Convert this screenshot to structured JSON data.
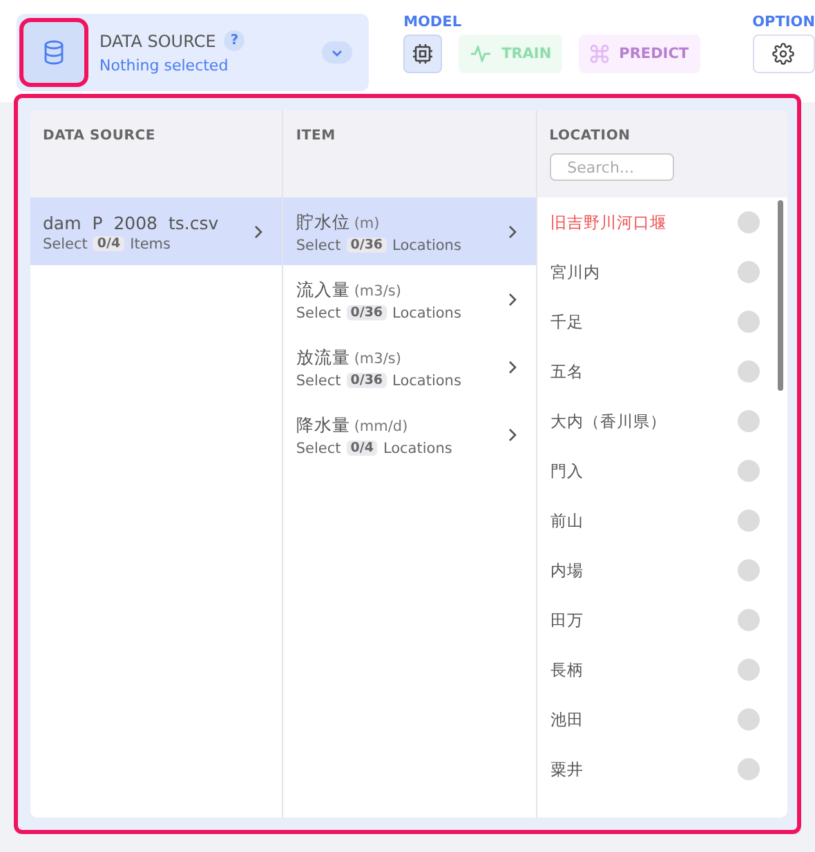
{
  "data_source": {
    "title": "DATA SOURCE",
    "help": "?",
    "status": "Nothing selected"
  },
  "model": {
    "label": "MODEL",
    "buttons": [
      {
        "kind": "chip",
        "selected": true
      },
      {
        "kind": "train",
        "label": "TRAIN",
        "selected": false
      },
      {
        "kind": "predict",
        "label": "PREDICT",
        "selected": false
      }
    ]
  },
  "option": {
    "label": "OPTION"
  },
  "columns": [
    "DATA SOURCE",
    "ITEM",
    "LOCATION"
  ],
  "search": {
    "placeholder": "Search..."
  },
  "sources": [
    {
      "name": "dam  P  2008  ts.csv",
      "prefix": "Select",
      "count": "0/4",
      "suffix": "Items",
      "selected": true
    }
  ],
  "items": [
    {
      "name": "貯水位",
      "unit": "(m)",
      "prefix": "Select",
      "count": "0/36",
      "suffix": "Locations",
      "selected": true
    },
    {
      "name": "流入量",
      "unit": "(m3/s)",
      "prefix": "Select",
      "count": "0/36",
      "suffix": "Locations",
      "selected": false
    },
    {
      "name": "放流量",
      "unit": "(m3/s)",
      "prefix": "Select",
      "count": "0/36",
      "suffix": "Locations",
      "selected": false
    },
    {
      "name": "降水量",
      "unit": "(mm/d)",
      "prefix": "Select",
      "count": "0/4",
      "suffix": "Locations",
      "selected": false
    }
  ],
  "locations": [
    {
      "name": "旧吉野川河口堰",
      "highlighted": true,
      "selected": false
    },
    {
      "name": "宮川内",
      "highlighted": false,
      "selected": false
    },
    {
      "name": "千足",
      "highlighted": false,
      "selected": false
    },
    {
      "name": "五名",
      "highlighted": false,
      "selected": false
    },
    {
      "name": "大内（香川県）",
      "highlighted": false,
      "selected": false
    },
    {
      "name": "門入",
      "highlighted": false,
      "selected": false
    },
    {
      "name": "前山",
      "highlighted": false,
      "selected": false
    },
    {
      "name": "内場",
      "highlighted": false,
      "selected": false
    },
    {
      "name": "田万",
      "highlighted": false,
      "selected": false
    },
    {
      "name": "長柄",
      "highlighted": false,
      "selected": false
    },
    {
      "name": "池田",
      "highlighted": false,
      "selected": false
    },
    {
      "name": "粟井",
      "highlighted": false,
      "selected": false
    }
  ]
}
